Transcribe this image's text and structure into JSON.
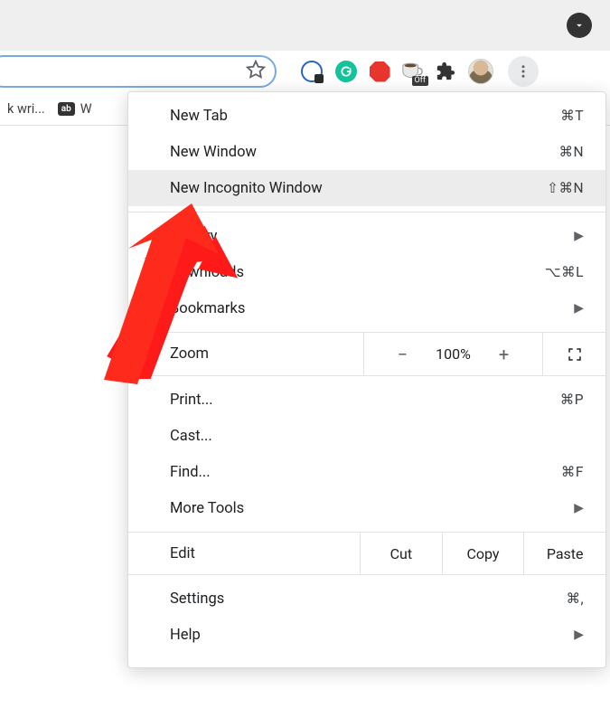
{
  "coffee_badge": "Off",
  "bookmark_bar": {
    "items": [
      {
        "label": "k wri..."
      },
      {
        "label": "W"
      }
    ]
  },
  "menu": {
    "new_tab": {
      "label": "New Tab",
      "shortcut": "⌘T"
    },
    "new_window": {
      "label": "New Window",
      "shortcut": "⌘N"
    },
    "new_incognito": {
      "label": "New Incognito Window",
      "shortcut": "⇧⌘N"
    },
    "history": {
      "label": "History"
    },
    "downloads": {
      "label": "Downloads",
      "shortcut": "⌥⌘L"
    },
    "bookmarks": {
      "label": "Bookmarks"
    },
    "zoom": {
      "label": "Zoom",
      "value": "100%",
      "minus": "−",
      "plus": "+"
    },
    "print": {
      "label": "Print...",
      "shortcut": "⌘P"
    },
    "cast": {
      "label": "Cast..."
    },
    "find": {
      "label": "Find...",
      "shortcut": "⌘F"
    },
    "more_tools": {
      "label": "More Tools"
    },
    "edit": {
      "label": "Edit",
      "cut": "Cut",
      "copy": "Copy",
      "paste": "Paste"
    },
    "settings": {
      "label": "Settings",
      "shortcut": "⌘,"
    },
    "help": {
      "label": "Help"
    }
  }
}
